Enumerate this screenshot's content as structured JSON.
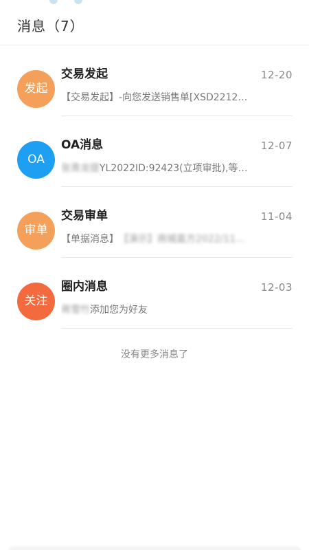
{
  "header": {
    "title": "消息（7）"
  },
  "messages": [
    {
      "avatar_text": "发起",
      "avatar_color": "#F5A05A",
      "title": "交易发起",
      "date": "12-20",
      "preview": "【交易发起】-向您发送销售单[XSD2212…",
      "preview_blurred": ""
    },
    {
      "avatar_text": "OA",
      "avatar_color": "#1E9FF2",
      "title": "OA消息",
      "date": "12-07",
      "preview_blurred": "张青龙提",
      "preview": "YL2022ID:92423(立项审批),等…"
    },
    {
      "avatar_text": "审单",
      "avatar_color": "#F5A05A",
      "title": "交易审单",
      "date": "11-04",
      "preview": "【单据消息】",
      "preview_blurred": "【演示】商城直方2022/11…"
    },
    {
      "avatar_text": "关注",
      "avatar_color": "#F26A3D",
      "title": "圈内消息",
      "date": "12-03",
      "preview_blurred": "蒋雪竹",
      "preview": "添加您为好友"
    }
  ],
  "footer": {
    "no_more_text": "没有更多消息了"
  }
}
